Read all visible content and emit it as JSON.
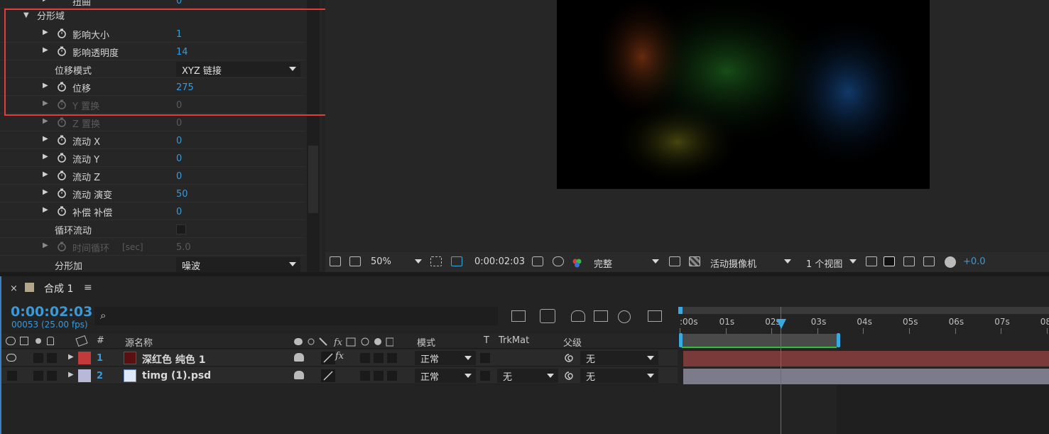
{
  "effect_controls": {
    "top_partial_label": "扭曲",
    "top_partial_value": "0",
    "group_label": "分形域",
    "rows": [
      {
        "name": "影响大小",
        "value": "1",
        "stopwatch": true,
        "expand": true,
        "dim": false
      },
      {
        "name": "影响透明度",
        "value": "14",
        "stopwatch": true,
        "expand": true,
        "dim": false
      },
      {
        "name": "位移模式",
        "value": "XYZ 链接",
        "type": "select"
      },
      {
        "name": "位移",
        "value": "275",
        "stopwatch": true,
        "expand": true,
        "dim": false
      },
      {
        "name": "Y 置换",
        "value": "0",
        "stopwatch": true,
        "expand": true,
        "dim": true
      },
      {
        "name": "Z 置换",
        "value": "0",
        "stopwatch": true,
        "expand": true,
        "dim": true
      },
      {
        "name": "流动 X",
        "value": "0",
        "stopwatch": true,
        "expand": true,
        "dim": false
      },
      {
        "name": "流动 Y",
        "value": "0",
        "stopwatch": true,
        "expand": true,
        "dim": false
      },
      {
        "name": "流动 Z",
        "value": "0",
        "stopwatch": true,
        "expand": true,
        "dim": false
      },
      {
        "name": "流动 演变",
        "value": "50",
        "stopwatch": true,
        "expand": true,
        "dim": false
      },
      {
        "name": "补偿   补偿",
        "value": "0",
        "stopwatch": true,
        "expand": true,
        "dim": false
      },
      {
        "name": "循环流动",
        "value": "",
        "type": "checkbox"
      },
      {
        "name": "时间循环",
        "unit": "[sec]",
        "value": "5.0",
        "stopwatch": true,
        "expand": true,
        "dim": true
      },
      {
        "name": "分形加",
        "value": "噪波",
        "type": "select"
      }
    ]
  },
  "viewer_toolbar": {
    "zoom": "50%",
    "timecode": "0:00:02:03",
    "resolution": "完整",
    "camera": "活动摄像机",
    "views": "1 个视图",
    "exposure": "+0.0"
  },
  "timeline": {
    "tab_title": "合成 1",
    "close_glyph": "×",
    "menu_glyph": "≡",
    "timecode": "0:00:02:03",
    "frames_fps": "00053 (25.00 fps)",
    "headers": {
      "num": "#",
      "source_name": "源名称",
      "mode": "模式",
      "t": "T",
      "trkmat": "TrkMat",
      "parent": "父级"
    },
    "layers": [
      {
        "num": "1",
        "name": "深红色 纯色 1",
        "color": "#c23a3a",
        "thumb": "#5a1010",
        "mode": "正常",
        "trkmat": "",
        "parent": "无",
        "fx": "fx"
      },
      {
        "num": "2",
        "name": "timg (1).psd",
        "color": "#b8b8d8",
        "thumb": "psd",
        "mode": "正常",
        "trkmat": "无",
        "parent": "无",
        "fx": ""
      }
    ],
    "ruler_ticks": [
      ":00s",
      "01s",
      "02s",
      "03s",
      "04s",
      "05s",
      "06s",
      "07s",
      "08"
    ]
  },
  "colors": {
    "accent_blue": "#3a9ad9",
    "highlight_red": "#e33c3c",
    "playhead": "#e23b3b"
  }
}
